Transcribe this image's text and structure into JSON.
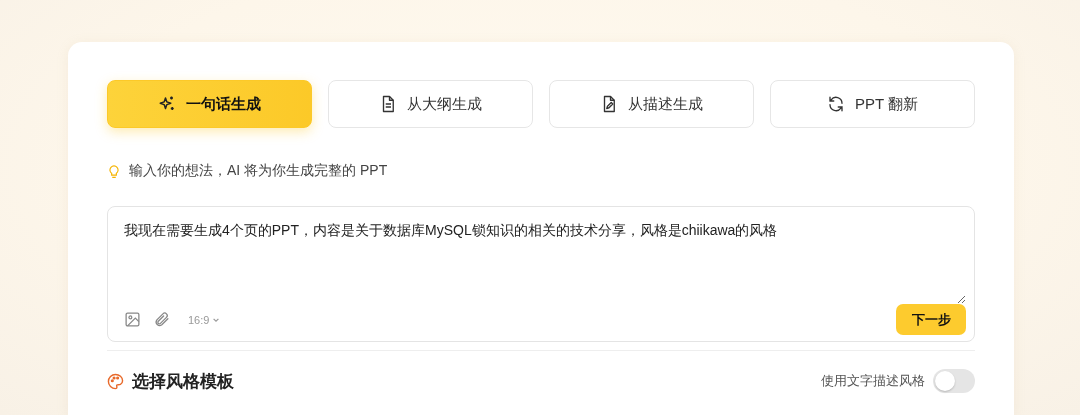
{
  "tabs": [
    {
      "label": "一句话生成",
      "selected": true
    },
    {
      "label": "从大纲生成",
      "selected": false
    },
    {
      "label": "从描述生成",
      "selected": false
    },
    {
      "label": "PPT 翻新",
      "selected": false
    }
  ],
  "hint": "输入你的想法，AI 将为你生成完整的 PPT",
  "prompt": {
    "value": "我现在需要生成4个页的PPT，内容是关于数据库MySQL锁知识的相关的技术分享，风格是chiikawa的风格",
    "ratio": "16:9",
    "submit": "下一步"
  },
  "style_section": {
    "title": "选择风格模板",
    "toggle_label": "使用文字描述风格",
    "toggle_on": false
  }
}
